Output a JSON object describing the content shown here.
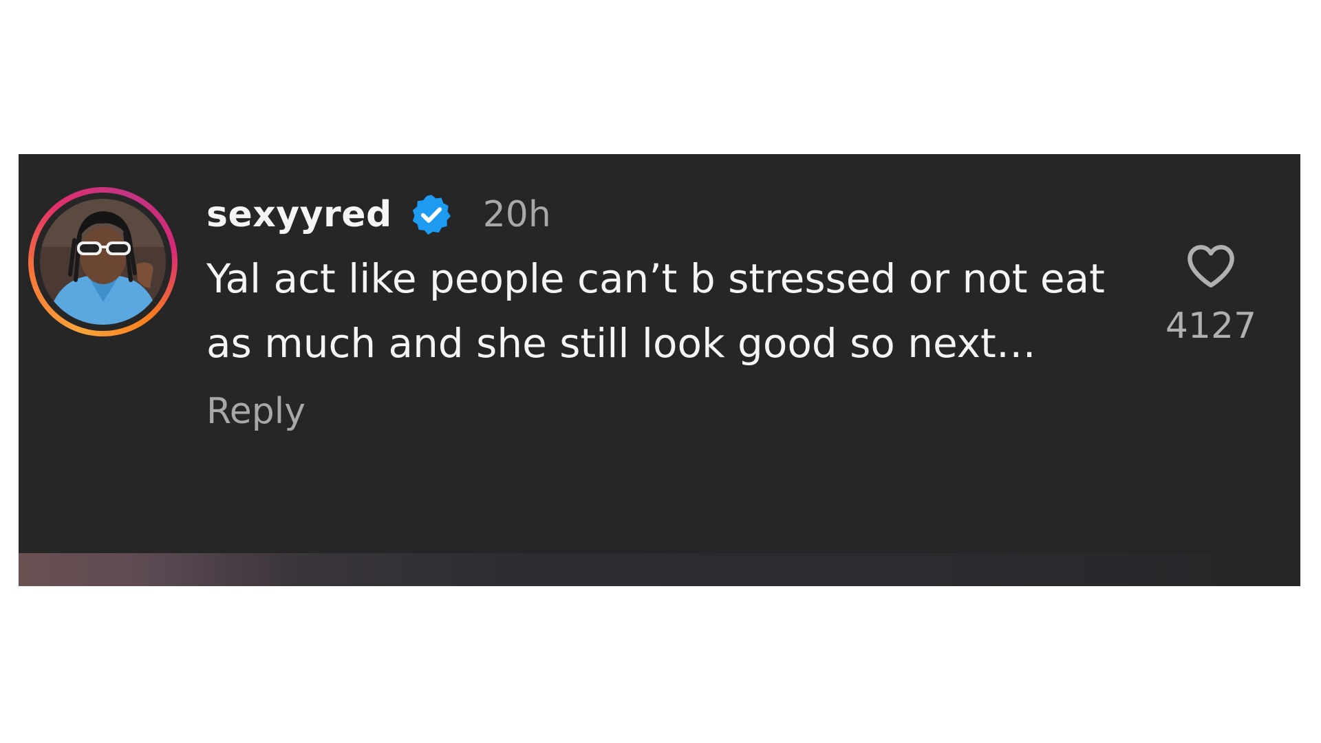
{
  "comment": {
    "username": "sexyyred",
    "verified_icon": "verified-badge-icon",
    "timestamp": "20h",
    "text": "Yal act like people can’t b stressed or not eat as much and she still look good so next…",
    "reply_label": "Reply",
    "like_icon": "heart-outline-icon",
    "like_count": "4127"
  },
  "colors": {
    "card_background": "#262626",
    "primary_text": "#f5f5f5",
    "secondary_text": "#a8a8a8",
    "verified_blue": "#1d9bf0"
  }
}
